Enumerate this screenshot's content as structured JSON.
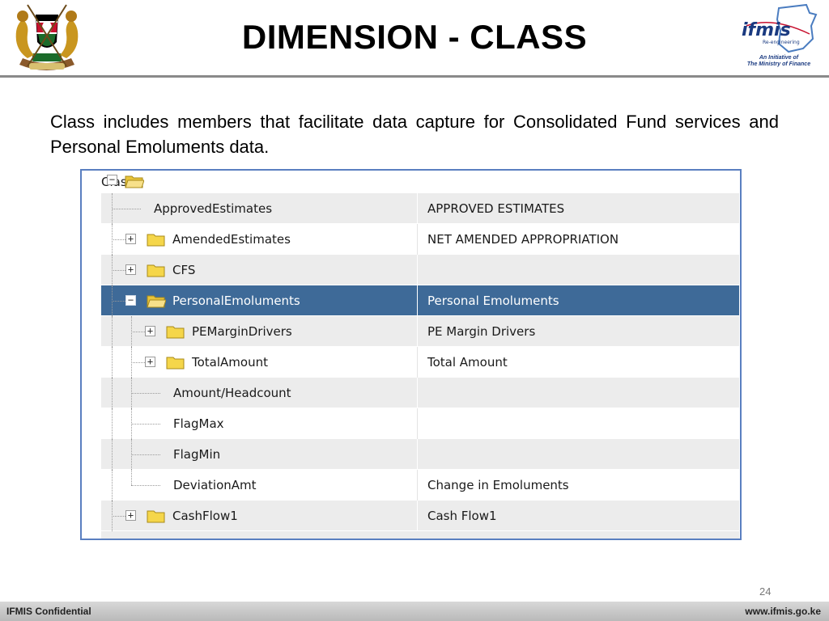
{
  "slide": {
    "title": "DIMENSION - CLASS",
    "intro": "Class includes members that facilitate data capture for Consolidated Fund services and Personal Emoluments data.",
    "page_number": "24"
  },
  "logos": {
    "left": "coat-of-arms",
    "right": {
      "brand": "ifmis",
      "sub": "Re-engineering",
      "tagline_1": "An Initiative of",
      "tagline_2": "The Ministry of Finance"
    }
  },
  "tree": {
    "root": "Class",
    "rows": [
      {
        "name": "ApprovedEstimates",
        "description": "APPROVED ESTIMATES",
        "expander": "none",
        "folder": false
      },
      {
        "name": "AmendedEstimates",
        "description": "NET AMENDED APPROPRIATION",
        "expander": "plus",
        "folder": true
      },
      {
        "name": "CFS",
        "description": "",
        "expander": "plus",
        "folder": true
      },
      {
        "name": "PersonalEmoluments",
        "description": "Personal Emoluments",
        "expander": "minus",
        "folder": true,
        "selected": true
      },
      {
        "name": "PEMarginDrivers",
        "description": "PE Margin Drivers",
        "expander": "plus",
        "folder": true
      },
      {
        "name": "TotalAmount",
        "description": "Total Amount",
        "expander": "plus",
        "folder": true
      },
      {
        "name": "Amount/Headcount",
        "description": "",
        "expander": "none",
        "folder": false
      },
      {
        "name": "FlagMax",
        "description": "",
        "expander": "none",
        "folder": false
      },
      {
        "name": "FlagMin",
        "description": "",
        "expander": "none",
        "folder": false
      },
      {
        "name": "DeviationAmt",
        "description": "Change in Emoluments",
        "expander": "none",
        "folder": false
      },
      {
        "name": "CashFlow1",
        "description": "Cash Flow1",
        "expander": "plus",
        "folder": true
      }
    ]
  },
  "footer": {
    "left": "IFMIS Confidential",
    "right": "www.ifmis.go.ke"
  },
  "colors": {
    "selected_row": "#3e6a98",
    "alt_row": "#ececec",
    "frame_border": "#5a7fc0",
    "folder": "#f5d64a"
  }
}
